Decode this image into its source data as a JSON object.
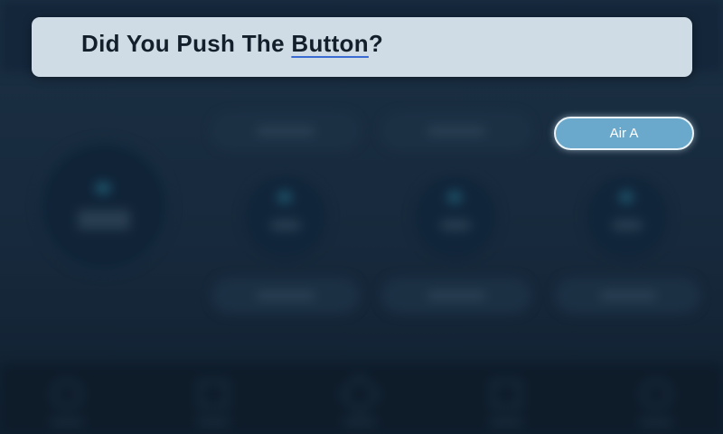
{
  "dialog": {
    "title_before": "Did You Push The ",
    "title_link": "Button",
    "title_after": "?"
  },
  "buttons": {
    "air_a_label": "Air A"
  },
  "colors": {
    "accent": "#6aa9cc",
    "title_card": "#cfdbe5",
    "background": "#17293c",
    "underline": "#3a6bd2"
  }
}
